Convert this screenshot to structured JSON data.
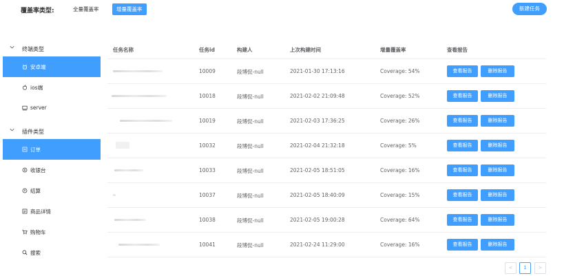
{
  "header": {
    "coverage_type_label": "覆盖率类型:",
    "full_coverage_label": "全量覆盖率",
    "incremental_coverage_label": "增量覆盖率",
    "new_task_label": "新建任务"
  },
  "sidebar": {
    "groups": [
      {
        "title": "终端类型",
        "items": [
          {
            "label": "安卓端",
            "icon": "android-icon",
            "active": true
          },
          {
            "label": "ios端",
            "icon": "apple-icon",
            "active": false
          },
          {
            "label": "server",
            "icon": "monitor-icon",
            "active": false
          }
        ]
      },
      {
        "title": "插件类型",
        "items": [
          {
            "label": "订单",
            "icon": "order-icon",
            "active": true
          },
          {
            "label": "收银台",
            "icon": "cashier-icon",
            "active": false
          },
          {
            "label": "结算",
            "icon": "settlement-icon",
            "active": false
          },
          {
            "label": "商品详情",
            "icon": "product-detail-icon",
            "active": false
          },
          {
            "label": "购物车",
            "icon": "cart-icon",
            "active": false
          },
          {
            "label": "搜索",
            "icon": "search-icon",
            "active": false
          }
        ]
      }
    ]
  },
  "table": {
    "columns": [
      "任务名称",
      "任务id",
      "构建人",
      "上次构建时间",
      "增量覆盖率",
      "查看报告"
    ],
    "view_button_label": "查看报告",
    "delete_button_label": "删除报告",
    "rows": [
      {
        "task_id": "10009",
        "builder": "段博侃-null",
        "last_build": "2021-01-30 17:13:16",
        "coverage": "Coverage: 54%"
      },
      {
        "task_id": "10018",
        "builder": "段博侃-null",
        "last_build": "2021-02-02 21:09:48",
        "coverage": "Coverage: 52%"
      },
      {
        "task_id": "10019",
        "builder": "段博侃-null",
        "last_build": "2021-02-03 17:36:25",
        "coverage": "Coverage: 26%"
      },
      {
        "task_id": "10032",
        "builder": "段博侃-null",
        "last_build": "2021-02-04 21:32:18",
        "coverage": "Coverage: 5%"
      },
      {
        "task_id": "10033",
        "builder": "段博侃-null",
        "last_build": "2021-02-05 18:51:05",
        "coverage": "Coverage: 16%"
      },
      {
        "task_id": "10037",
        "builder": "段博侃-null",
        "last_build": "2021-02-05 18:40:09",
        "coverage": "Coverage: 15%"
      },
      {
        "task_id": "10038",
        "builder": "段博侃-null",
        "last_build": "2021-02-05 19:00:28",
        "coverage": "Coverage: 64%"
      },
      {
        "task_id": "10041",
        "builder": "段博侃-null",
        "last_build": "2021-02-24 11:29:00",
        "coverage": "Coverage: 16%"
      }
    ]
  },
  "pagination": {
    "prev": "<",
    "current_page": "1",
    "next": ">"
  },
  "colors": {
    "primary": "#409eff",
    "text": "#303133",
    "muted": "#606266",
    "border": "#ebeef5"
  }
}
